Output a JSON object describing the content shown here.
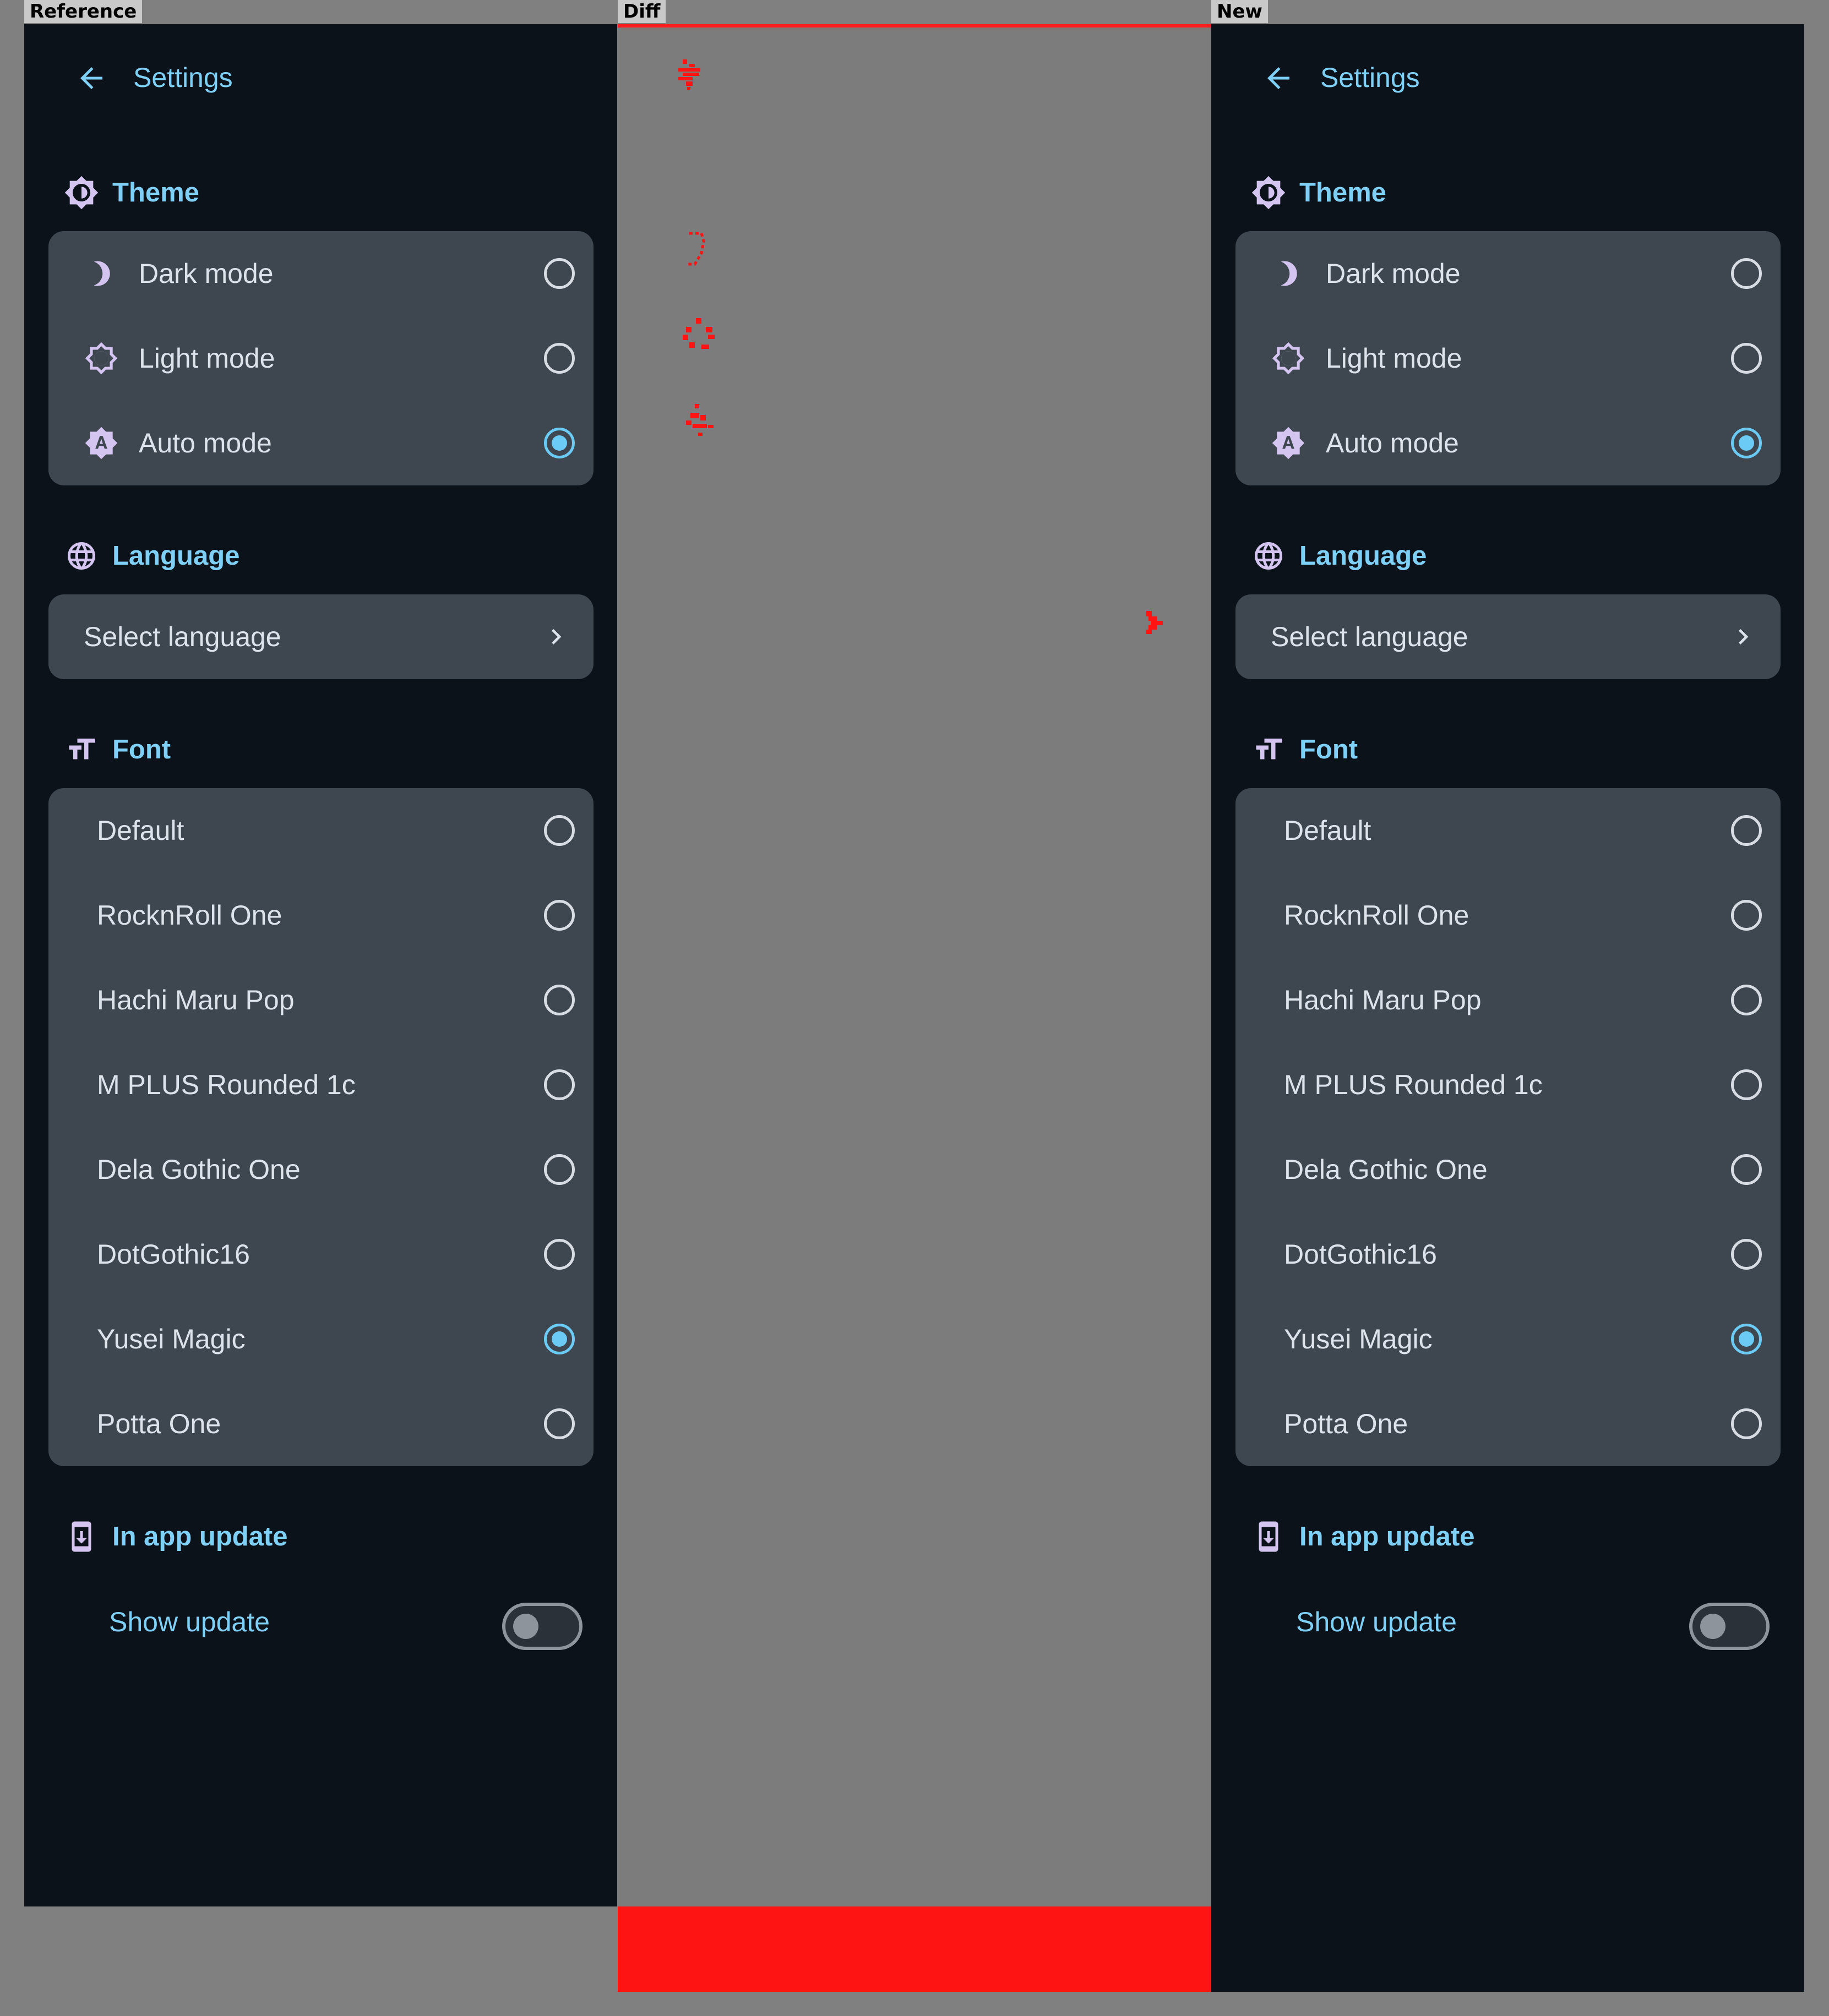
{
  "strip_labels": {
    "reference": "Reference",
    "diff": "Diff",
    "new": "New"
  },
  "app": {
    "title": "Settings",
    "icons": {
      "back": "arrow-left-icon"
    },
    "theme": {
      "heading": "Theme",
      "icon": "brightness-icon",
      "options": [
        {
          "label": "Dark mode",
          "icon": "moon-icon",
          "selected": false
        },
        {
          "label": "Light mode",
          "icon": "sun-icon",
          "selected": false
        },
        {
          "label": "Auto mode",
          "icon": "auto-brightness-icon",
          "selected": true
        }
      ]
    },
    "language": {
      "heading": "Language",
      "icon": "globe-icon",
      "select_label": "Select language"
    },
    "font": {
      "heading": "Font",
      "icon": "text-size-icon",
      "options": [
        {
          "label": "Default",
          "selected": false
        },
        {
          "label": "RocknRoll One",
          "selected": false
        },
        {
          "label": "Hachi Maru Pop",
          "selected": false
        },
        {
          "label": "M PLUS Rounded 1c",
          "selected": false
        },
        {
          "label": "Dela Gothic One",
          "selected": false
        },
        {
          "label": "DotGothic16",
          "selected": false
        },
        {
          "label": "Yusei Magic",
          "selected": true
        },
        {
          "label": "Potta One",
          "selected": false
        }
      ]
    },
    "update": {
      "heading": "In app update",
      "icon": "system-update-icon",
      "toggle_label": "Show update",
      "toggle_on": false
    }
  },
  "colors": {
    "background": "#0b121a",
    "card": "#3e4650",
    "accent": "#7fd0f7",
    "icon_lavender": "#d4c5f0",
    "diff_marker": "#ff1414"
  }
}
